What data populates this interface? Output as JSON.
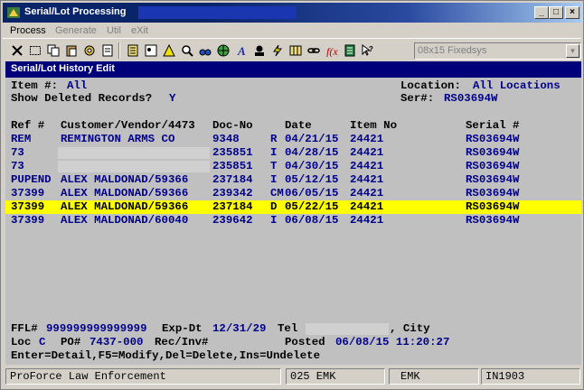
{
  "window": {
    "title": "Serial/Lot Processing"
  },
  "menu": [
    {
      "label": "Process",
      "disabled": false
    },
    {
      "label": "Generate",
      "disabled": true
    },
    {
      "label": "Util",
      "disabled": true
    },
    {
      "label": "eXit",
      "disabled": true
    }
  ],
  "toolbar": {
    "font_value": "08x15 Fixedsys",
    "icons": [
      "close-icon",
      "select-icon",
      "copy-icon",
      "paste-icon",
      "settings-icon",
      "clipboard-icon",
      "calculator-icon",
      "notes-icon",
      "alert-icon",
      "search-icon",
      "binoculars-icon",
      "globe-icon",
      "script-icon",
      "user-icon",
      "lightning-icon",
      "map-icon",
      "link-icon",
      "function-icon",
      "document-icon",
      "help-pointer-icon"
    ]
  },
  "screen": {
    "heading": "Serial/Lot History Edit",
    "item_label": "Item #:",
    "item_value": "All",
    "location_label": "Location:",
    "location_value": "All Locations",
    "deleted_label": "Show Deleted Records?",
    "deleted_value": "Y",
    "ser_label": "Ser#:",
    "ser_value": "RS03694W",
    "columns": [
      "Ref #",
      "Customer/Vendor/4473",
      "Doc-No",
      "Date",
      "Item No",
      "Serial #"
    ],
    "rows": [
      {
        "ref": "REM",
        "customer": "REMINGTON ARMS CO",
        "doc": "9348",
        "type": "R",
        "date": "04/21/15",
        "item": "24421",
        "serial": "RS03694W",
        "masked": false,
        "selected": false
      },
      {
        "ref": "73",
        "customer": "",
        "doc": "235851",
        "type": "I",
        "date": "04/28/15",
        "item": "24421",
        "serial": "RS03694W",
        "masked": true,
        "selected": false
      },
      {
        "ref": "73",
        "customer": "",
        "doc": "235851",
        "type": "T",
        "date": "04/30/15",
        "item": "24421",
        "serial": "RS03694W",
        "masked": true,
        "selected": false
      },
      {
        "ref": "PUPEND",
        "customer": "ALEX MALDONAD/59366",
        "doc": "237184",
        "type": "I",
        "date": "05/12/15",
        "item": "24421",
        "serial": "RS03694W",
        "masked": false,
        "selected": false
      },
      {
        "ref": "37399",
        "customer": "ALEX MALDONAD/59366",
        "doc": "239342",
        "type": "CM",
        "date": "06/05/15",
        "item": "24421",
        "serial": "RS03694W",
        "masked": false,
        "selected": false
      },
      {
        "ref": "37399",
        "customer": "ALEX MALDONAD/59366",
        "doc": "237184",
        "type": "D",
        "date": "05/22/15",
        "item": "24421",
        "serial": "RS03694W",
        "masked": false,
        "selected": true
      },
      {
        "ref": "37399",
        "customer": "ALEX MALDONAD/60040",
        "doc": "239642",
        "type": "I",
        "date": "06/08/15",
        "item": "24421",
        "serial": "RS03694W",
        "masked": false,
        "selected": false
      }
    ],
    "ffl_label": "FFL#",
    "ffl_value": "999999999999999",
    "exp_label": "Exp-Dt",
    "exp_value": "12/31/29",
    "tel_label": "Tel",
    "city_label": ", City",
    "loc_label": "Loc",
    "loc_value": "C",
    "po_label": "PO#",
    "po_value": "7437-000",
    "recinv_label": "Rec/Inv#",
    "posted_label": "Posted",
    "posted_value": "06/08/15 11:20:27",
    "help_line": "Enter=Detail,F5=Modify,Del=Delete,Ins=Undelete"
  },
  "status": {
    "company": "ProForce Law Enforcement",
    "station": "025 EMK",
    "user": "EMK",
    "program": "IN1903"
  }
}
